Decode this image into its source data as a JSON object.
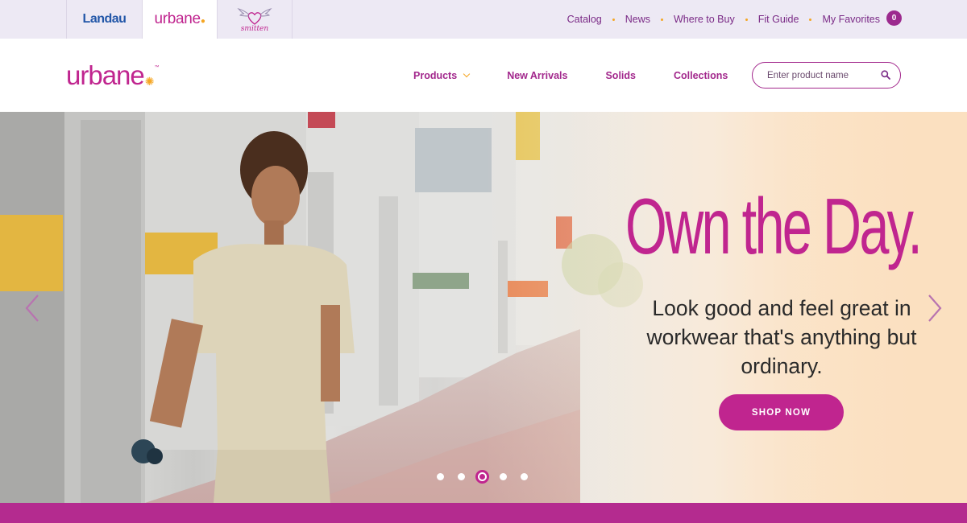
{
  "brands": {
    "landau": "Landau",
    "urbane": "urbane",
    "smitten": "smitten"
  },
  "utility_nav": {
    "items": [
      "Catalog",
      "News",
      "Where to Buy",
      "Fit Guide",
      "My Favorites"
    ],
    "favorites_count": "0"
  },
  "header": {
    "logo": "urbane",
    "nav": [
      "Products",
      "New Arrivals",
      "Solids",
      "Collections"
    ],
    "search_placeholder": "Enter product name"
  },
  "hero": {
    "headline": "Own the Day.",
    "subtext": "Look good and feel great in workwear that's anything but ordinary.",
    "cta": "SHOP NOW",
    "slide_count": 5,
    "active_slide": 3
  },
  "colors": {
    "brand_magenta": "#c0258f",
    "accent_orange": "#f5a623",
    "topbar_bg": "#ede9f4",
    "bottom_band": "#b42b8f"
  }
}
